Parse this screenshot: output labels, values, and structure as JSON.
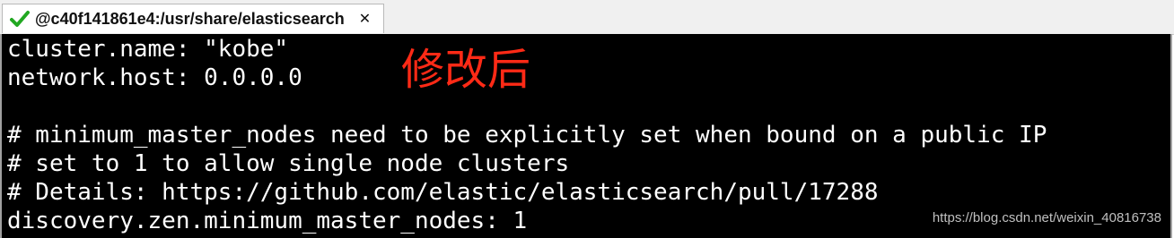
{
  "tab": {
    "title": "@c40f141861e4:/usr/share/elasticsearch",
    "status_icon": "green-checkmark",
    "close_label": "✕"
  },
  "terminal": {
    "lines": [
      "cluster.name: \"kobe\"",
      "network.host: 0.0.0.0",
      "",
      "# minimum_master_nodes need to be explicitly set when bound on a public IP",
      "# set to 1 to allow single node clusters",
      "# Details: https://github.com/elastic/elasticsearch/pull/17288",
      "discovery.zen.minimum_master_nodes: 1"
    ],
    "background_color": "#000000",
    "text_color": "#ffffff"
  },
  "annotation": {
    "text": "修改后",
    "color": "#ff2a16"
  },
  "watermark": "https://blog.csdn.net/weixin_40816738"
}
